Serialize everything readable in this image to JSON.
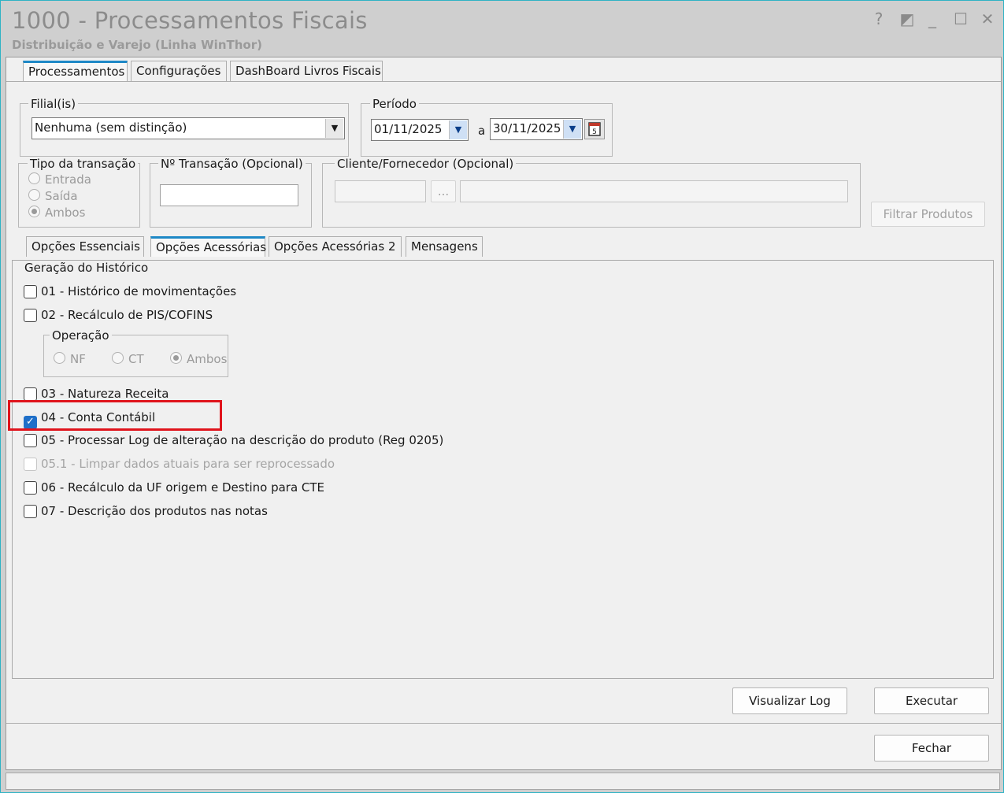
{
  "window": {
    "title": "1000 - Processamentos Fiscais",
    "subtitle": "Distribuição e Varejo (Linha WinThor)",
    "controls": {
      "help": "?",
      "restore": "◩",
      "minimize": "_",
      "maximize": "☐",
      "close": "✕"
    }
  },
  "main_tabs": [
    "Processamentos",
    "Configurações",
    "DashBoard Livros Fiscais"
  ],
  "filial": {
    "legend": "Filial(is)",
    "value": "Nenhuma (sem distinção)"
  },
  "periodo": {
    "legend": "Período",
    "from": "01/11/2025",
    "separator": "a",
    "to": "30/11/2025"
  },
  "tipo_transacao": {
    "legend": "Tipo da transação",
    "options": [
      "Entrada",
      "Saída",
      "Ambos"
    ],
    "selected": "Ambos"
  },
  "num_transacao": {
    "legend": "Nº Transação (Opcional)",
    "value": ""
  },
  "cliente_fornecedor": {
    "legend": "Cliente/Fornecedor (Opcional)",
    "browse": "...",
    "code": "",
    "name": ""
  },
  "filtrar_produtos": "Filtrar Produtos",
  "sub_tabs": [
    "Opções Essenciais",
    "Opções Acessórias",
    "Opções Acessórias 2",
    "Mensagens"
  ],
  "historico": {
    "title": "Geração do Histórico",
    "items": [
      {
        "label": "01 - Histórico de movimentações",
        "checked": false,
        "enabled": true
      },
      {
        "label": "02 - Recálculo de PIS/COFINS",
        "checked": false,
        "enabled": true
      },
      {
        "label": "03 - Natureza Receita",
        "checked": false,
        "enabled": true
      },
      {
        "label": "04 - Conta Contábil",
        "checked": true,
        "enabled": true
      },
      {
        "label": "05 - Processar Log de alteração na descrição do produto (Reg 0205)",
        "checked": false,
        "enabled": true
      },
      {
        "label": "05.1 - Limpar dados atuais para ser reprocessado",
        "checked": false,
        "enabled": false
      },
      {
        "label": "06 - Recálculo da UF origem e Destino para CTE",
        "checked": false,
        "enabled": true
      },
      {
        "label": "07 - Descrição dos produtos nas notas",
        "checked": false,
        "enabled": true
      }
    ],
    "operacao": {
      "legend": "Operação",
      "options": [
        "NF",
        "CT",
        "Ambos"
      ],
      "selected": "Ambos"
    }
  },
  "buttons": {
    "visualizar_log": "Visualizar Log",
    "executar": "Executar",
    "fechar": "Fechar"
  },
  "colors": {
    "accent_tab": "#1e88c6",
    "highlight": "#e0141c",
    "check_blue": "#1f6fc8"
  }
}
